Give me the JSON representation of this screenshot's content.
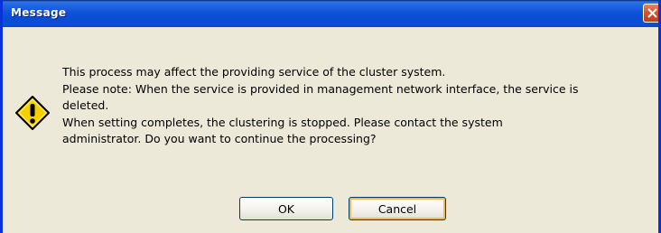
{
  "dialog": {
    "title": "Message",
    "close_icon": "close-x-icon",
    "warning_icon": "exclamation-warning-icon",
    "message_lines": [
      "This process may affect the providing service of the cluster system.",
      "Please note: When the service is provided in management network interface, the service is",
      "deleted.",
      "When setting completes, the clustering is stopped. Please contact the system",
      "administrator. Do you want to continue the processing?"
    ],
    "buttons": {
      "ok_label": "OK",
      "cancel_label": "Cancel"
    }
  },
  "colors": {
    "titlebar": "#0A4CD4",
    "window_border": "#0831D9",
    "dialog_background": "#ECE9D8",
    "close_button": "#D9532F",
    "warning_fill": "#F5D000",
    "focus_ring": "#F7B64B"
  }
}
